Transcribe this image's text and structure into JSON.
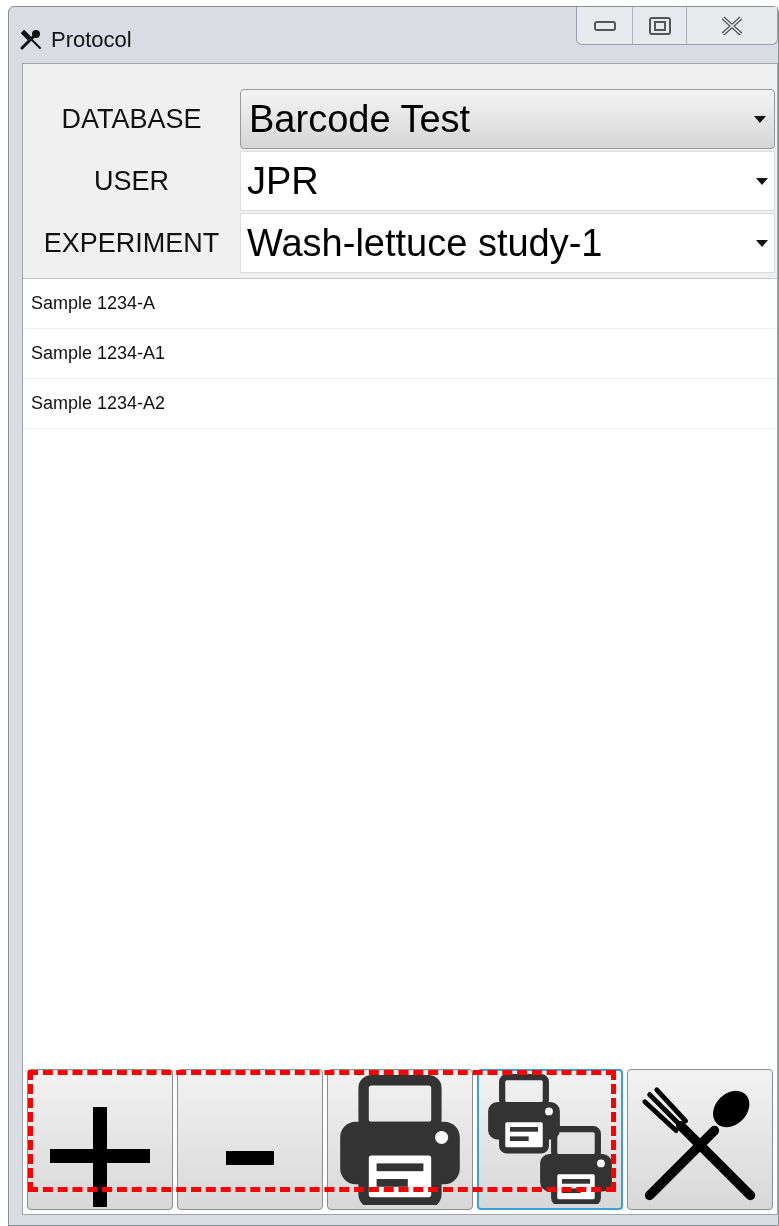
{
  "window": {
    "title": "Protocol"
  },
  "fields": [
    {
      "label": "DATABASE",
      "value": "Barcode Test",
      "hovered": true
    },
    {
      "label": "USER",
      "value": "JPR",
      "hovered": false
    },
    {
      "label": "EXPERIMENT",
      "value": "Wash-lettuce study-1",
      "hovered": false
    }
  ],
  "samples": [
    "Sample 1234-A",
    "Sample 1234-A1",
    "Sample 1234-A2"
  ],
  "buttons": [
    {
      "kind": "add",
      "focused": false
    },
    {
      "kind": "remove",
      "focused": false
    },
    {
      "kind": "print",
      "focused": false
    },
    {
      "kind": "print-all",
      "focused": true
    },
    {
      "kind": "close",
      "focused": false
    }
  ],
  "annotation": {
    "kind": "dashed-frame",
    "color": "#ff0000"
  }
}
